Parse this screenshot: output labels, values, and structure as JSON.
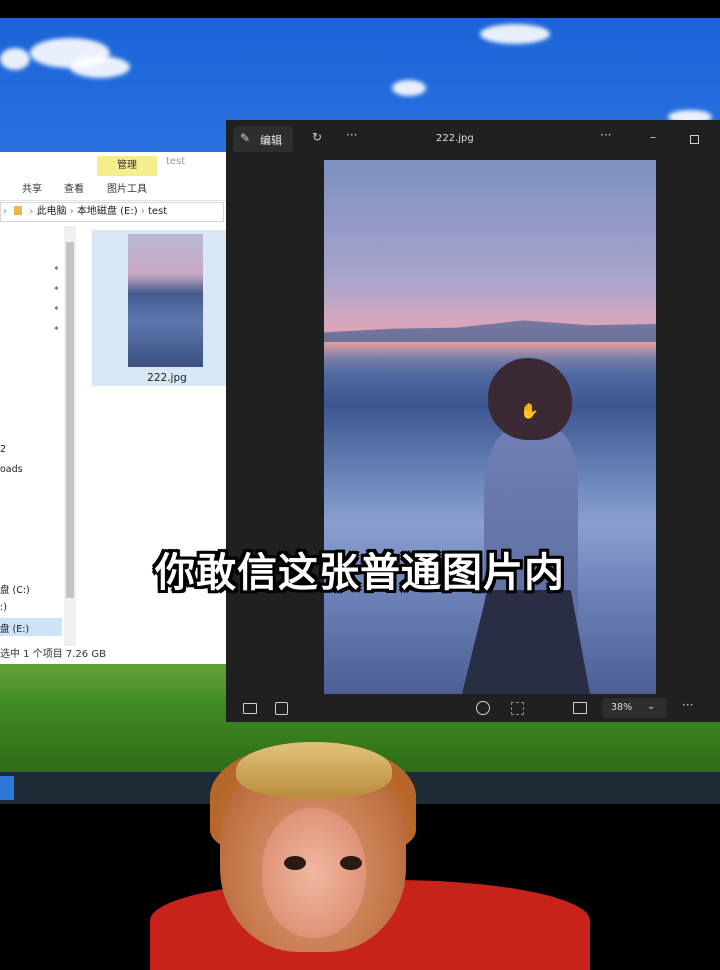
{
  "explorer": {
    "ribbon_tabs": [
      "共享",
      "查看",
      "图片工具"
    ],
    "manage_tab": "管理",
    "folder_title": "test",
    "address": [
      "此电脑",
      "本地磁盘 (E:)",
      "test"
    ],
    "nav_items": [
      "2",
      "oads",
      "盘 (C:)",
      ":)",
      "盘 (E:)"
    ],
    "file_name": "222.jpg",
    "status": "选中 1 个项目  7.26 GB"
  },
  "viewer": {
    "edit_label": "编辑",
    "title": "222.jpg",
    "zoom": "38%",
    "more": "···"
  },
  "caption": "你敢信这张普通图片内",
  "colors": {
    "manage_tab": "#f5ee8e",
    "viewer_bg": "#202020",
    "robe": "#c8231b"
  }
}
